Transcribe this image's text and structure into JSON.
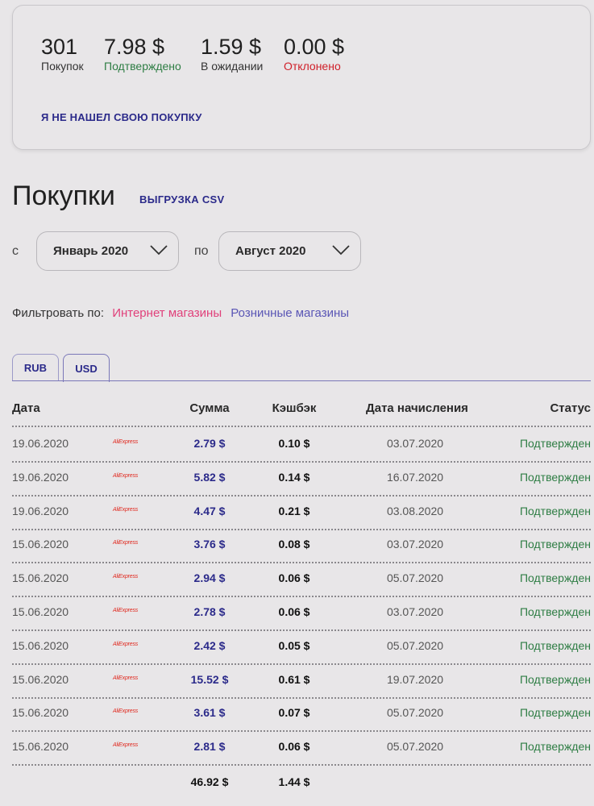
{
  "summary": {
    "purchases": {
      "value": "301",
      "label": "Покупок"
    },
    "confirmed": {
      "value": "7.98 $",
      "label": "Подтверждено"
    },
    "pending": {
      "value": "1.59 $",
      "label": "В ожидании"
    },
    "rejected": {
      "value": "0.00 $",
      "label": "Отклонено"
    },
    "not_found_link": "Я НЕ НАШЕЛ СВОЮ ПОКУПКУ"
  },
  "page": {
    "title": "Покупки",
    "csv_link": "ВЫГРУЗКА CSV"
  },
  "range": {
    "from_label": "с",
    "from_value": "Январь 2020",
    "to_label": "по",
    "to_value": "Август 2020"
  },
  "filter": {
    "label": "Фильтровать по:",
    "online": "Интернет магазины",
    "retail": "Розничные магазины"
  },
  "tabs": [
    {
      "label": "RUB"
    },
    {
      "label": "USD"
    }
  ],
  "table": {
    "headers": {
      "date": "Дата",
      "amount": "Сумма",
      "cashback": "Кэшбэк",
      "accrual": "Дата начисления",
      "status": "Статус"
    },
    "rows": [
      {
        "date": "19.06.2020",
        "shop": "AliExpress",
        "amount": "2.79 $",
        "cashback": "0.10 $",
        "accrual": "03.07.2020",
        "status": "Подтвержден"
      },
      {
        "date": "19.06.2020",
        "shop": "AliExpress",
        "amount": "5.82 $",
        "cashback": "0.14 $",
        "accrual": "16.07.2020",
        "status": "Подтвержден"
      },
      {
        "date": "19.06.2020",
        "shop": "AliExpress",
        "amount": "4.47 $",
        "cashback": "0.21 $",
        "accrual": "03.08.2020",
        "status": "Подтвержден"
      },
      {
        "date": "15.06.2020",
        "shop": "AliExpress",
        "amount": "3.76 $",
        "cashback": "0.08 $",
        "accrual": "03.07.2020",
        "status": "Подтвержден"
      },
      {
        "date": "15.06.2020",
        "shop": "AliExpress",
        "amount": "2.94 $",
        "cashback": "0.06 $",
        "accrual": "05.07.2020",
        "status": "Подтвержден"
      },
      {
        "date": "15.06.2020",
        "shop": "AliExpress",
        "amount": "2.78 $",
        "cashback": "0.06 $",
        "accrual": "03.07.2020",
        "status": "Подтвержден"
      },
      {
        "date": "15.06.2020",
        "shop": "AliExpress",
        "amount": "2.42 $",
        "cashback": "0.05 $",
        "accrual": "05.07.2020",
        "status": "Подтвержден"
      },
      {
        "date": "15.06.2020",
        "shop": "AliExpress",
        "amount": "15.52 $",
        "cashback": "0.61 $",
        "accrual": "19.07.2020",
        "status": "Подтвержден"
      },
      {
        "date": "15.06.2020",
        "shop": "AliExpress",
        "amount": "3.61 $",
        "cashback": "0.07 $",
        "accrual": "05.07.2020",
        "status": "Подтвержден"
      },
      {
        "date": "15.06.2020",
        "shop": "AliExpress",
        "amount": "2.81 $",
        "cashback": "0.06 $",
        "accrual": "05.07.2020",
        "status": "Подтвержден"
      }
    ],
    "totals": {
      "amount": "46.92 $",
      "cashback": "1.44 $"
    }
  },
  "colors": {
    "accent": "#2b2a8a",
    "confirmed": "#2e7d44",
    "rejected": "#d0202a",
    "shop_logo": "#e0281e"
  }
}
